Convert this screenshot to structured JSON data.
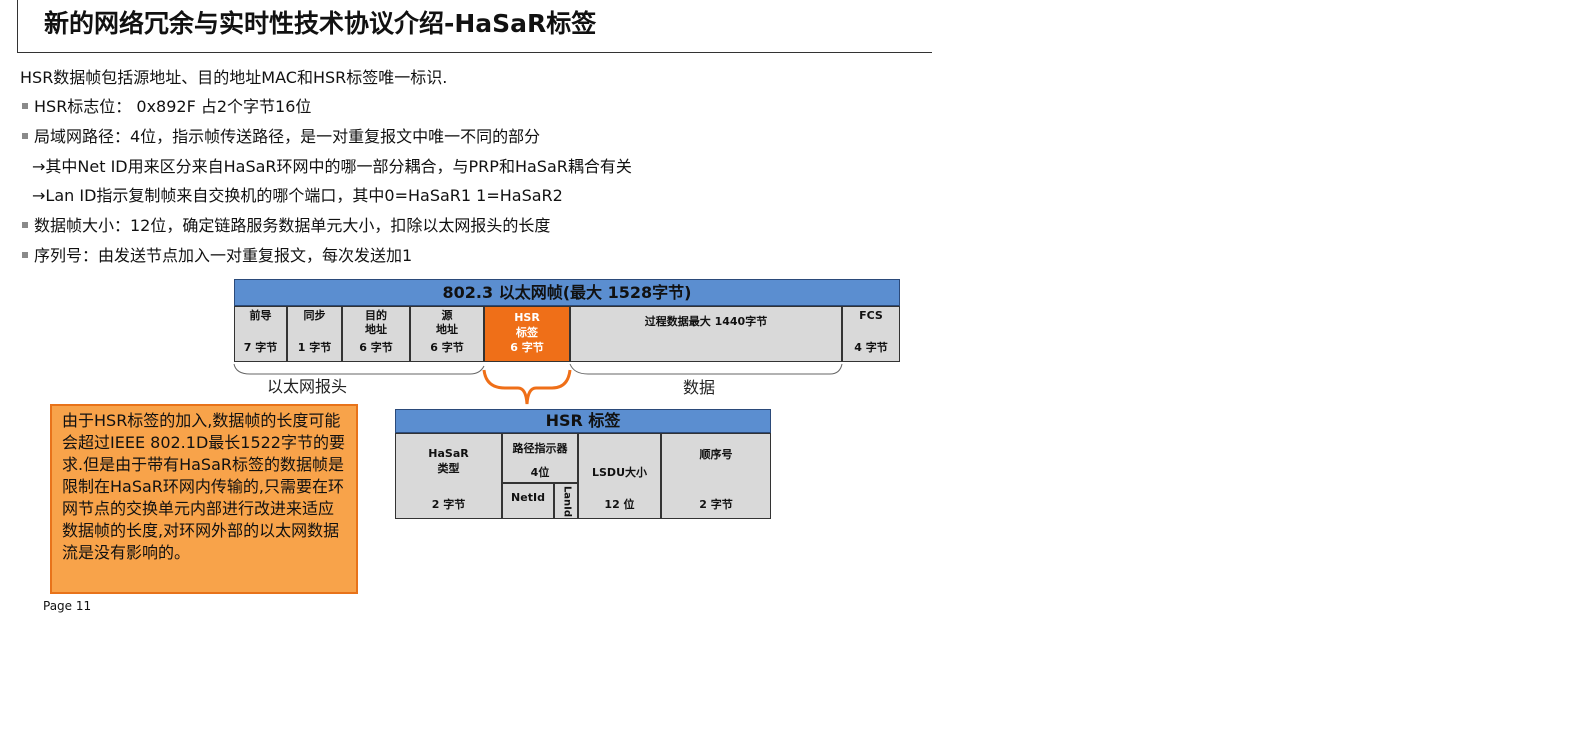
{
  "title": "新的网络冗余与实时性技术协议介绍-HaSaR标签",
  "intro": "HSR数据帧包括源地址、目的地址MAC和HSR标签唯一标识.",
  "bullets": [
    "HSR标志位： 0x892F 占2个字节16位",
    "局域网路径：4位，指示帧传送路径，是一对重复报文中唯一不同的部分",
    "→其中Net ID用来区分来自HaSaR环网中的哪一部分耦合，与PRP和HaSaR耦合有关",
    "→Lan ID指示复制帧来自交换机的哪个端口，其中0=HaSaR1 1=HaSaR2",
    "数据帧大小：12位，确定链路服务数据单元大小，扣除以太网报头的长度",
    "序列号：由发送节点加入一对重复报文，每次发送加1"
  ],
  "frame": {
    "header": "802.3 以太网帧(最大 1528字节)",
    "cells": [
      {
        "name": "前导",
        "size": "7 字节"
      },
      {
        "name": "同步",
        "size": "1 字节"
      },
      {
        "name": "目的\n地址",
        "size": "6 字节"
      },
      {
        "name": "源\n地址",
        "size": "6 字节"
      },
      {
        "name": "HSR\n标签\n6 字节",
        "size": ""
      },
      {
        "name": "过程数据最大 1440字节",
        "size": ""
      },
      {
        "name": "FCS",
        "size": "4 字节"
      }
    ],
    "brace_header": "以太网报头",
    "brace_data": "数据"
  },
  "tag": {
    "header": "HSR 标签",
    "hasar_name": "HaSaR\n类型",
    "hasar_size": "2 字节",
    "path_name": "路径指示器",
    "path_size": "4位",
    "netid": "NetId",
    "lanid": "LanId",
    "lsdu_name": "LSDU大小",
    "lsdu_size": "12 位",
    "seq_name": "顺序号",
    "seq_size": "2 字节"
  },
  "note": "由于HSR标签的加入,数据帧的长度可能会超过IEEE 802.1D最长1522字节的要求.但是由于带有HaSaR标签的数据帧是限制在HaSaR环网内传输的,只需要在环网节点的交换单元内部进行改进来适应数据帧的长度,对环网外部的以太网数据流是没有影响的。",
  "page": "Page 11",
  "colors": {
    "header_blue": "#5b8ed0",
    "hsr_orange": "#ef6f18",
    "note_bg": "#f8a34a",
    "cell_gray": "#d9d9d9"
  }
}
